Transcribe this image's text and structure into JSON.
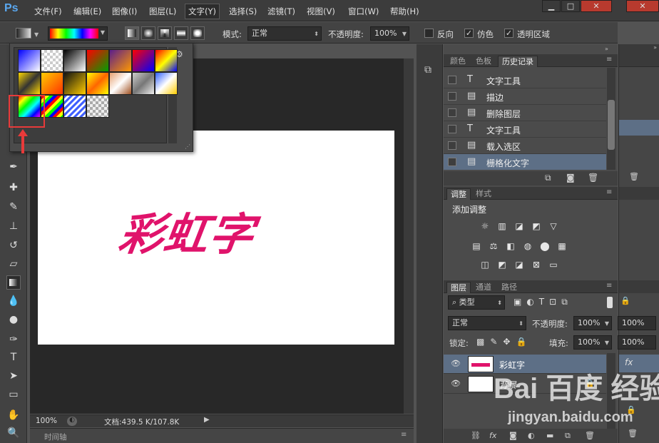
{
  "app": {
    "logo": "Ps"
  },
  "menu": [
    "文件(F)",
    "编辑(E)",
    "图像(I)",
    "图层(L)",
    "文字(Y)",
    "选择(S)",
    "滤镜(T)",
    "视图(V)",
    "窗口(W)",
    "帮助(H)"
  ],
  "options": {
    "mode_label": "模式:",
    "mode_value": "正常",
    "opacity_label": "不透明度:",
    "opacity_value": "100%",
    "reverse_label": "反向",
    "dither_label": "仿色",
    "transparency_label": "透明区域"
  },
  "gradient_picker": {
    "swatches": [
      "linear-gradient(135deg,#0000ff,#fff)",
      "repeating-conic-gradient(#ccc 0 25%,#fff 0 50%) 0 0/8px 8px",
      "linear-gradient(135deg,#000,#fff)",
      "linear-gradient(135deg,#ff0000,#00a000)",
      "linear-gradient(135deg,#5a1e8c,#ff9900)",
      "linear-gradient(135deg,#ff0000,#0000ff)",
      "linear-gradient(135deg,#ff0000,#ffff00,#0000ff)",
      "linear-gradient(135deg,#ffd700,#333,#ffd700)",
      "linear-gradient(135deg,#ffcc00,#ff3300)",
      "linear-gradient(135deg,#111,#ffcc00)",
      "linear-gradient(135deg,#ffff00,#ff6600,#ffff00)",
      "linear-gradient(135deg,#e6a070,#fff,#a05020)",
      "linear-gradient(135deg,#ccc,#777,#eee)",
      "linear-gradient(135deg,#3060ff,#fff,#ffcc00)",
      "linear-gradient(135deg,#ff0000,#ffff00,#00ff00,#00ffff,#0000ff,#ff00ff)",
      "repeating-linear-gradient(135deg,#ff0000 0 4px,#ffff00 4px 8px,#00ff00 8px 12px,#0000ff 12px 16px)",
      "repeating-linear-gradient(135deg,#4060ff 0 3px,#fff 3px 6px)",
      "repeating-conic-gradient(#aaa 0 25%,#eee 0 50%) 0 0/8px 8px"
    ]
  },
  "panels": {
    "history_tabs": [
      "颜色",
      "色板",
      "历史记录"
    ],
    "history_items": [
      "文字工具",
      "描边",
      "删除图层",
      "文字工具",
      "载入选区",
      "栅格化文字"
    ],
    "adjust_tabs": [
      "调整",
      "样式"
    ],
    "adjust_title": "添加调整",
    "layers_tabs": [
      "图层",
      "通道",
      "路径"
    ],
    "filter_label": "类型",
    "blend_mode": "正常",
    "opacity_label": "不透明度:",
    "opacity_value": "100%",
    "lock_label": "锁定:",
    "fill_label": "填充:",
    "fill_value": "100%",
    "layers": [
      "彩虹字",
      "背景"
    ],
    "far_opacity": "100%",
    "far_fill": "100%"
  },
  "document": {
    "text": "彩虹字"
  },
  "status": {
    "zoom": "100%",
    "doc_info": "文档:439.5 K/107.8K",
    "timeline": "时间轴"
  },
  "watermark": {
    "brand": "Bai 百度 经验",
    "url": "jingyan.baidu.com"
  },
  "colors": {
    "accent": "#5aa8f0",
    "text_color": "#e0136b",
    "highlight": "#e83a3a"
  }
}
